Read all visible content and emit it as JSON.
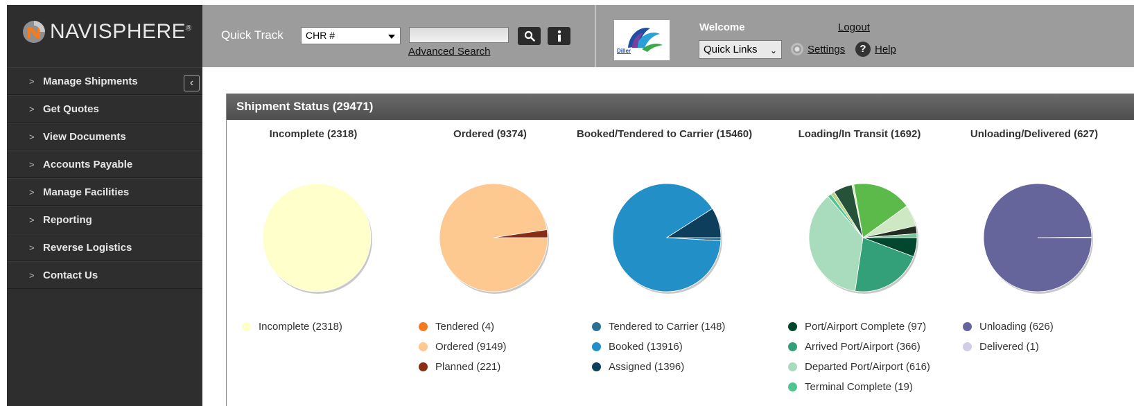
{
  "header": {
    "logo_text": "NAVISPHERE",
    "logo_reg": "®",
    "quick_track_label": "Quick Track",
    "quick_track_select": "CHR #",
    "advanced_search": "Advanced Search",
    "customer_logo_text": "Diller",
    "welcome": "Welcome",
    "logout": "Logout",
    "quick_links": "Quick Links",
    "settings": "Settings",
    "help": "Help"
  },
  "sidebar": {
    "items": [
      {
        "label": "Manage Shipments"
      },
      {
        "label": "Get Quotes"
      },
      {
        "label": "View Documents"
      },
      {
        "label": "Accounts Payable"
      },
      {
        "label": "Manage Facilities"
      },
      {
        "label": "Reporting"
      },
      {
        "label": "Reverse Logistics"
      },
      {
        "label": "Contact Us"
      }
    ]
  },
  "panel": {
    "title": "Shipment Status (29471)"
  },
  "chart_data": [
    {
      "type": "pie",
      "title": "Incomplete (2318)",
      "series": [
        {
          "label": "Incomplete (2318)",
          "value": 2318,
          "color": "#ffffcc"
        }
      ]
    },
    {
      "type": "pie",
      "title": "Ordered (9374)",
      "series": [
        {
          "label": "Tendered (4)",
          "value": 4,
          "color": "#f47b20"
        },
        {
          "label": "Ordered (9149)",
          "value": 9149,
          "color": "#fdc991"
        },
        {
          "label": "Planned (221)",
          "value": 221,
          "color": "#8b2c15"
        }
      ]
    },
    {
      "type": "pie",
      "title": "Booked/Tendered to Carrier (15460)",
      "series": [
        {
          "label": "Tendered to Carrier (148)",
          "value": 148,
          "color": "#2b6f93"
        },
        {
          "label": "Booked (13916)",
          "value": 13916,
          "color": "#2290c6"
        },
        {
          "label": "Assigned (1396)",
          "value": 1396,
          "color": "#0d3f5c"
        }
      ]
    },
    {
      "type": "pie",
      "title": "Loading/In Transit (1692)",
      "series": [
        {
          "label": "Port/Airport Complete (97)",
          "value": 97,
          "color": "#01462d"
        },
        {
          "label": "Arrived Port/Airport (366)",
          "value": 366,
          "color": "#33a07a"
        },
        {
          "label": "Departed Port/Airport (616)",
          "value": 616,
          "color": "#a8dcbc"
        },
        {
          "label": "Terminal Complete (19)",
          "value": 19,
          "color": "#4fc491"
        },
        {
          "label": "",
          "value": 20,
          "color": "#b7d48c"
        },
        {
          "label": "",
          "value": 95,
          "color": "#26523a"
        },
        {
          "label": "",
          "value": 10,
          "color": "#d8e8b8"
        },
        {
          "label": "",
          "value": 300,
          "color": "#5cba4a"
        },
        {
          "label": "",
          "value": 110,
          "color": "#cfe8c4"
        },
        {
          "label": "",
          "value": 39,
          "color": "#222c20"
        },
        {
          "label": "",
          "value": 20,
          "color": "#79c89c"
        }
      ],
      "legend_count": 4
    },
    {
      "type": "pie",
      "title": "Unloading/Delivered (627)",
      "series": [
        {
          "label": "Unloading (626)",
          "value": 626,
          "color": "#65659b"
        },
        {
          "label": "Delivered (1)",
          "value": 1,
          "color": "#cfcde8"
        }
      ]
    }
  ]
}
